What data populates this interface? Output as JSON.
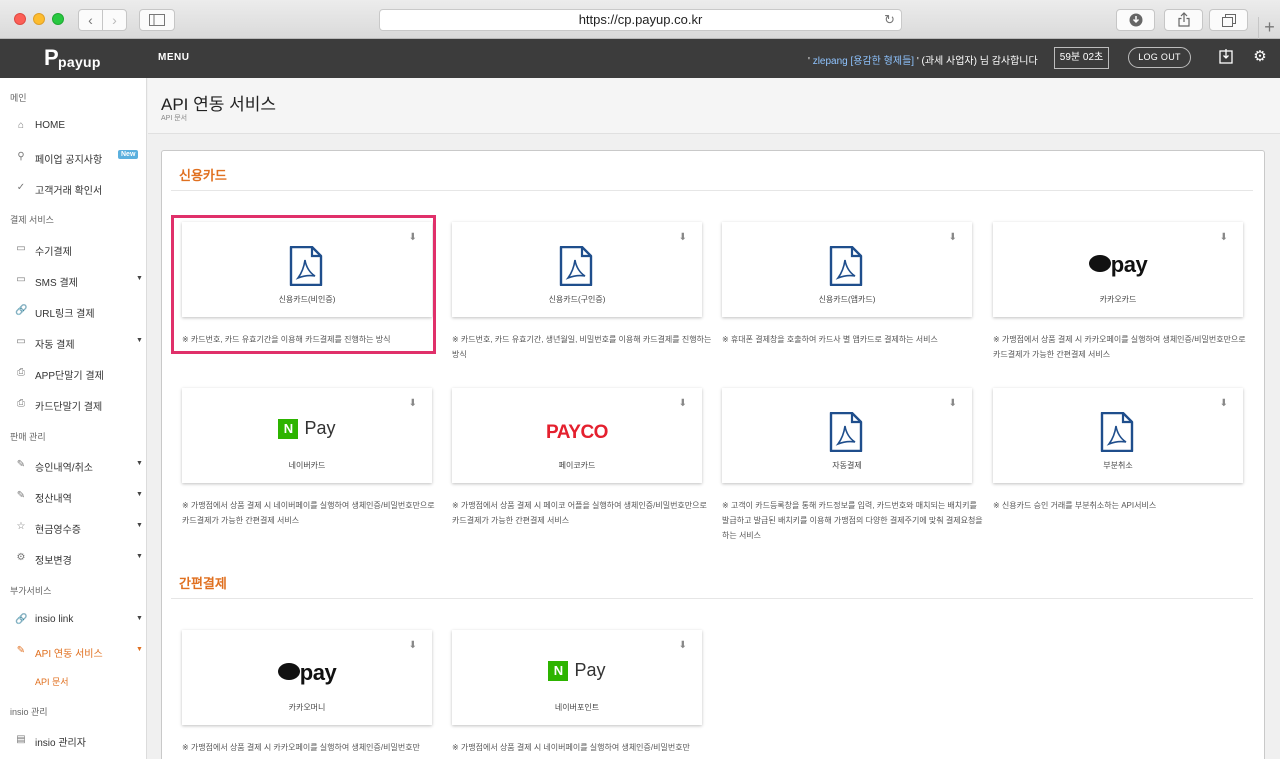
{
  "browser": {
    "url": "https://cp.payup.co.kr",
    "back_icon": "chevron-left-icon",
    "forward_icon": "chevron-right-icon",
    "reload_icon": "reload-icon"
  },
  "header": {
    "logo_text": "payup",
    "menu_label": "MENU",
    "greeting_prefix": "'",
    "username": " zlepang [용감한 형제들] ",
    "greeting_suffix": "' (과세 사업자) 님 감사합니다",
    "timer": "59분 02초",
    "logout_label": "LOG OUT"
  },
  "sidebar": {
    "sections": [
      {
        "label": "메인"
      },
      {
        "label": "결제 서비스"
      },
      {
        "label": "판매 관리"
      },
      {
        "label": "부가서비스"
      },
      {
        "label": "insio 관리"
      }
    ],
    "items": [
      {
        "label": "HOME",
        "icon": "home-icon"
      },
      {
        "label": "페이업 공지사항",
        "icon": "pin-icon",
        "badge": "New"
      },
      {
        "label": "고객거래 확인서",
        "icon": "check-circle-icon"
      },
      {
        "label": "수기결제",
        "icon": "card-icon"
      },
      {
        "label": "SMS 결제",
        "icon": "card-icon"
      },
      {
        "label": "URL링크 결제",
        "icon": "link-icon"
      },
      {
        "label": "자동 결제",
        "icon": "card-icon"
      },
      {
        "label": "APP단말기 결제",
        "icon": "printer-icon"
      },
      {
        "label": "카드단말기 결제",
        "icon": "printer-icon"
      },
      {
        "label": "승인내역/취소",
        "icon": "edit-icon"
      },
      {
        "label": "정산내역",
        "icon": "edit-icon"
      },
      {
        "label": "현금영수증",
        "icon": "star-icon"
      },
      {
        "label": "정보변경",
        "icon": "gear-icon"
      },
      {
        "label": "insio link",
        "icon": "link-icon"
      },
      {
        "label": "API 연동 서비스",
        "icon": "edit-icon"
      },
      {
        "label": "insio 관리자",
        "icon": "gift-icon"
      }
    ],
    "sub_item": "API 문서"
  },
  "page": {
    "title": "API 연동 서비스",
    "subtitle": "API 문서"
  },
  "sections": {
    "credit": "신용카드",
    "easy": "간편결제"
  },
  "cards": [
    {
      "name": "신용카드(비인증)",
      "desc": "※ 카드번호, 카드 유효기간을 이용해 카드결제를 진행하는 방식"
    },
    {
      "name": "신용카드(구인증)",
      "desc": "※ 카드번호, 카드 유효기간, 생년월일, 비밀번호를 이용해 카드결제를 진행하는 방식"
    },
    {
      "name": "신용카드(앱카드)",
      "desc": "※ 휴대폰 결제창을 호출하여 카드사 별 앱카드로 결제하는 서비스"
    },
    {
      "name": "카카오카드",
      "brand": "pay",
      "desc": "※ 가맹점에서 상품 결제 시 카카오페이를 실행하여 생체인증/비밀번호만으로 카드결제가 가능한 간편결제 서비스"
    },
    {
      "name": "네이버카드",
      "brand": "Pay",
      "brand_n": "N",
      "desc": "※ 가맹점에서 상품 결제 시 네이버페이를 실행하여 생체인증/비밀번호만으로 카드결제가 가능한 간편결제 서비스"
    },
    {
      "name": "페이코카드",
      "brand": "PAYCO",
      "desc": "※ 가맹점에서 상품 결제 시 페이코 어플을 실행하여 생체인증/비밀번호만으로 카드결제가 가능한 간편결제 서비스"
    },
    {
      "name": "자동결제",
      "desc": "※ 고객이 카드등록창을 통해 카드정보를 입력, 카드번호와 매치되는 배치키를 발급하고 발급된 배치키를 이용해 가맹점의 다양한 결제주기에 맞춰 결제요청을 하는 서비스"
    },
    {
      "name": "부분취소",
      "desc": "※ 신용카드 승인 거래를 부분취소하는 API서비스"
    },
    {
      "name": "카카오머니",
      "brand": "pay",
      "desc": "※ 가맹점에서 상품 결제 시 카카오페이를 실행하여 생체인증/비밀번호만"
    },
    {
      "name": "네이버포인트",
      "brand": "Pay",
      "brand_n": "N",
      "desc": "※ 가맹점에서 상품 결제 시 네이버페이를 실행하여 생체인증/비밀번호만"
    }
  ],
  "colors": {
    "accent": "#e07020",
    "highlight": "#e0306a",
    "header_bg": "#3c3c3c",
    "pdf_blue": "#1f4e8c"
  }
}
